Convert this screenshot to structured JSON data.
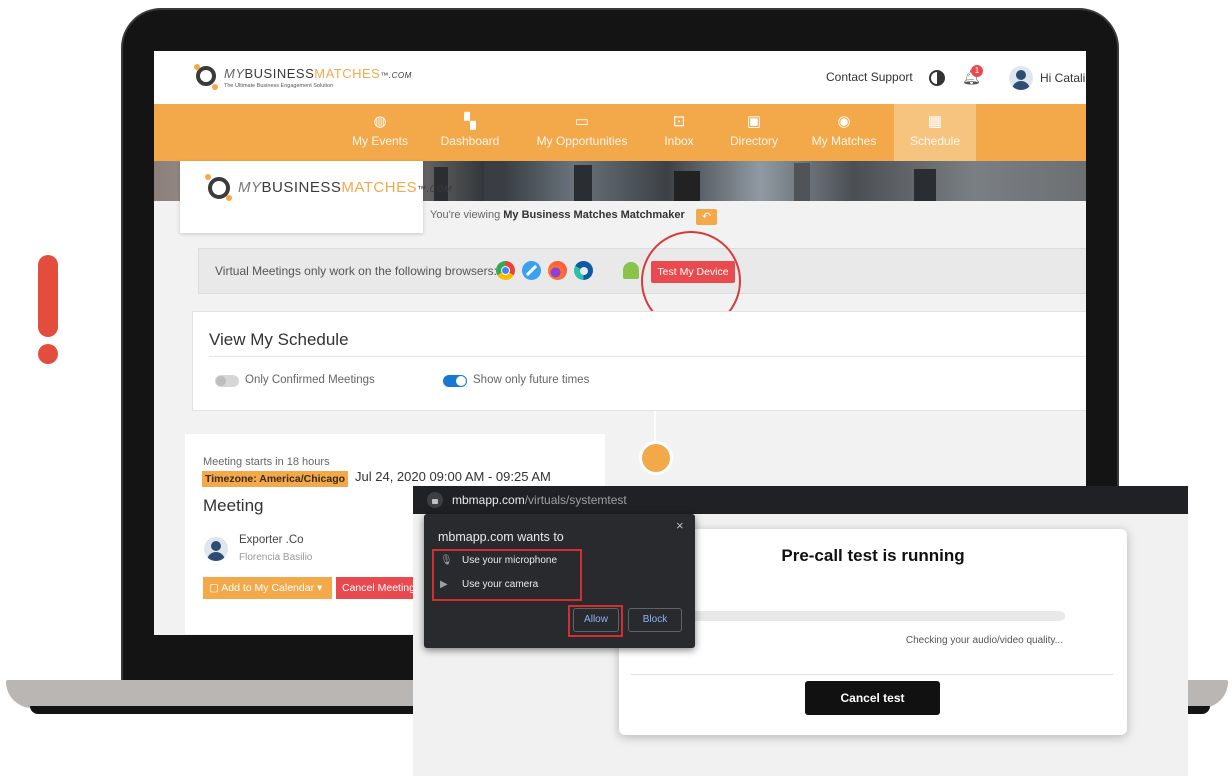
{
  "brand": {
    "logo_my": "MY",
    "logo_business": "BUSINESS",
    "logo_matches": "MATCHES",
    "logo_com": "™.COM",
    "tagline": "The Ultimate Business Engagement Solution"
  },
  "header": {
    "contact_support": "Contact Support",
    "notification_count": "1",
    "greeting": "Hi Catalin"
  },
  "nav": {
    "items": [
      {
        "label": "My Events",
        "icon": "globe-icon"
      },
      {
        "label": "Dashboard",
        "icon": "dashboard-icon"
      },
      {
        "label": "My Opportunities",
        "icon": "folder-icon"
      },
      {
        "label": "Inbox",
        "icon": "inbox-icon"
      },
      {
        "label": "Directory",
        "icon": "directory-icon"
      },
      {
        "label": "My Matches",
        "icon": "user-icon"
      },
      {
        "label": "Schedule",
        "icon": "calendar-icon"
      }
    ],
    "active": "Schedule"
  },
  "viewing": {
    "prefix": "You're viewing",
    "event": "My Business Matches Matchmaker"
  },
  "browsers": {
    "text": "Virtual Meetings only work on the following browsers:",
    "test_button": "Test My Device"
  },
  "schedule": {
    "title": "View My Schedule",
    "toggle_confirmed": "Only Confirmed Meetings",
    "toggle_future": "Show only future times"
  },
  "meeting": {
    "starts": "Meeting starts in 18 hours",
    "timezone": "Timezone: America/Chicago",
    "time": "Jul 24, 2020 09:00 AM - 09:25 AM",
    "title": "Meeting",
    "company": "Exporter .Co",
    "person": "Florencia Basilio",
    "add_calendar": "Add to My Calendar",
    "cancel": "Cancel Meeting"
  },
  "overlay": {
    "url_domain": "mbmapp.com",
    "url_path": "/virtuals/systemtest",
    "perm_title": "mbmapp.com wants to",
    "perm_mic": "Use your microphone",
    "perm_camera": "Use your camera",
    "allow": "Allow",
    "block": "Block",
    "close": "×"
  },
  "precall": {
    "title": "Pre-call test is running",
    "status": "Checking your audio/video quality...",
    "progress": 0.0,
    "cancel": "Cancel test"
  },
  "colors": {
    "accent": "#f3a94a",
    "danger": "#e84a4f",
    "alert": "#e44d3e"
  }
}
